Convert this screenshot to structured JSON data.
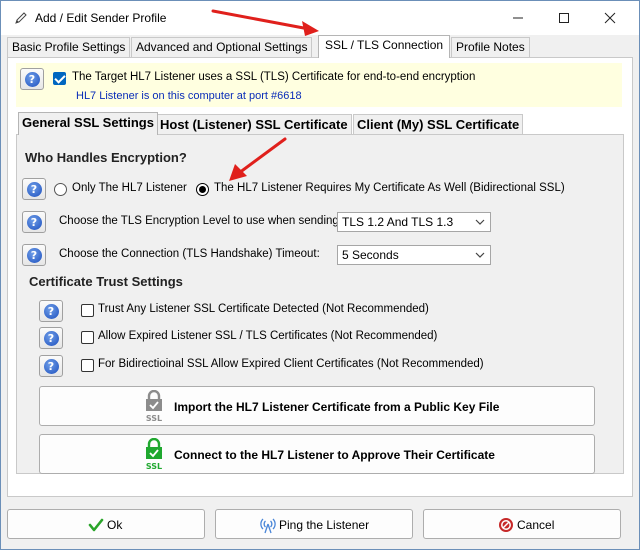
{
  "window": {
    "title": "Add / Edit Sender Profile"
  },
  "top_tabs": [
    {
      "label": "Basic Profile Settings"
    },
    {
      "label": "Advanced and Optional Settings"
    },
    {
      "label": "SSL / TLS Connection"
    },
    {
      "label": "Profile Notes"
    }
  ],
  "banner": {
    "checkbox_label": "The Target HL7 Listener uses a SSL (TLS) Certificate for end-to-end encryption",
    "checkbox_checked": true,
    "sub_text": "HL7 Listener is on this computer at port #6618"
  },
  "inner_tabs": [
    {
      "label": "General SSL Settings"
    },
    {
      "label": "Host (Listener) SSL Certificate"
    },
    {
      "label": "Client (My) SSL Certificate"
    }
  ],
  "encryption": {
    "heading": "Who Handles Encryption?",
    "option_one": "Only The HL7 Listener",
    "option_two": "The HL7 Listener Requires My Certificate As Well (Bidirectional SSL)",
    "selected": "option_two"
  },
  "tls_level": {
    "label": "Choose the TLS Encryption Level to use when sending:",
    "value": "TLS 1.2 And TLS 1.3"
  },
  "timeout": {
    "label": "Choose the Connection (TLS Handshake) Timeout:",
    "value": "5 Seconds"
  },
  "trust": {
    "heading": "Certificate Trust Settings",
    "items": [
      {
        "label": "Trust Any Listener SSL Certificate Detected (Not Recommended)",
        "checked": false
      },
      {
        "label": "Allow Expired Listener SSL / TLS Certificates (Not Recommended)",
        "checked": false
      },
      {
        "label": "For Bidirectioinal SSL Allow Expired Client Certificates (Not Recommended)",
        "checked": false
      }
    ]
  },
  "actions": {
    "import_label": "Import the HL7 Listener Certificate from a Public Key File",
    "connect_label": "Connect to the HL7 Listener to Approve Their Certificate",
    "ssl_badge": "SSL"
  },
  "footer": {
    "ok_label": "Ok",
    "ping_label": "Ping the Listener",
    "cancel_label": "Cancel"
  },
  "colors": {
    "annotation_arrow": "#e0201c",
    "ok_icon": "#2aa52a",
    "cancel_icon": "#c62828",
    "ssl_green": "#1fa82f"
  }
}
